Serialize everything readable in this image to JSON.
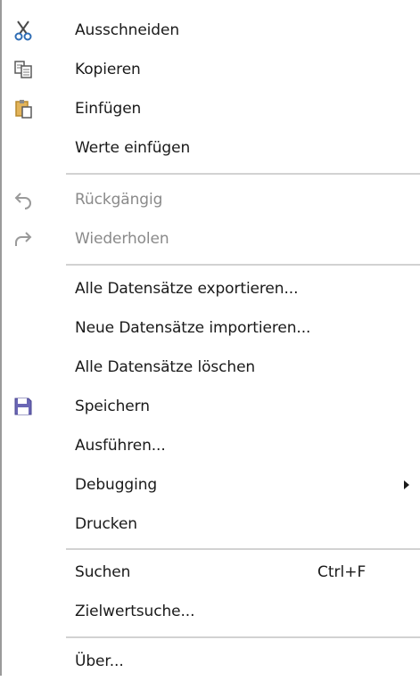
{
  "menu": {
    "items": [
      {
        "label": "Ausschneiden",
        "icon": "cut-icon"
      },
      {
        "label": "Kopieren",
        "icon": "copy-icon"
      },
      {
        "label": "Einfügen",
        "icon": "paste-icon"
      },
      {
        "label": "Werte einfügen"
      },
      {
        "label": "Rückgängig",
        "icon": "undo-icon",
        "disabled": true
      },
      {
        "label": "Wiederholen",
        "icon": "redo-icon",
        "disabled": true
      },
      {
        "label": "Alle Datensätze exportieren..."
      },
      {
        "label": "Neue Datensätze importieren..."
      },
      {
        "label": "Alle Datensätze löschen"
      },
      {
        "label": "Speichern",
        "icon": "save-icon"
      },
      {
        "label": "Ausführen..."
      },
      {
        "label": "Debugging",
        "submenu": true
      },
      {
        "label": "Drucken"
      },
      {
        "label": "Suchen",
        "shortcut": "Ctrl+F"
      },
      {
        "label": "Zielwertsuche..."
      },
      {
        "label": "Über..."
      }
    ]
  },
  "colors": {
    "text": "#1a1a1a",
    "disabled_text": "#8a8a8a",
    "separator": "#d2d2d2",
    "save_icon": "#5b57a8",
    "paste_icon": "#d9a441"
  }
}
